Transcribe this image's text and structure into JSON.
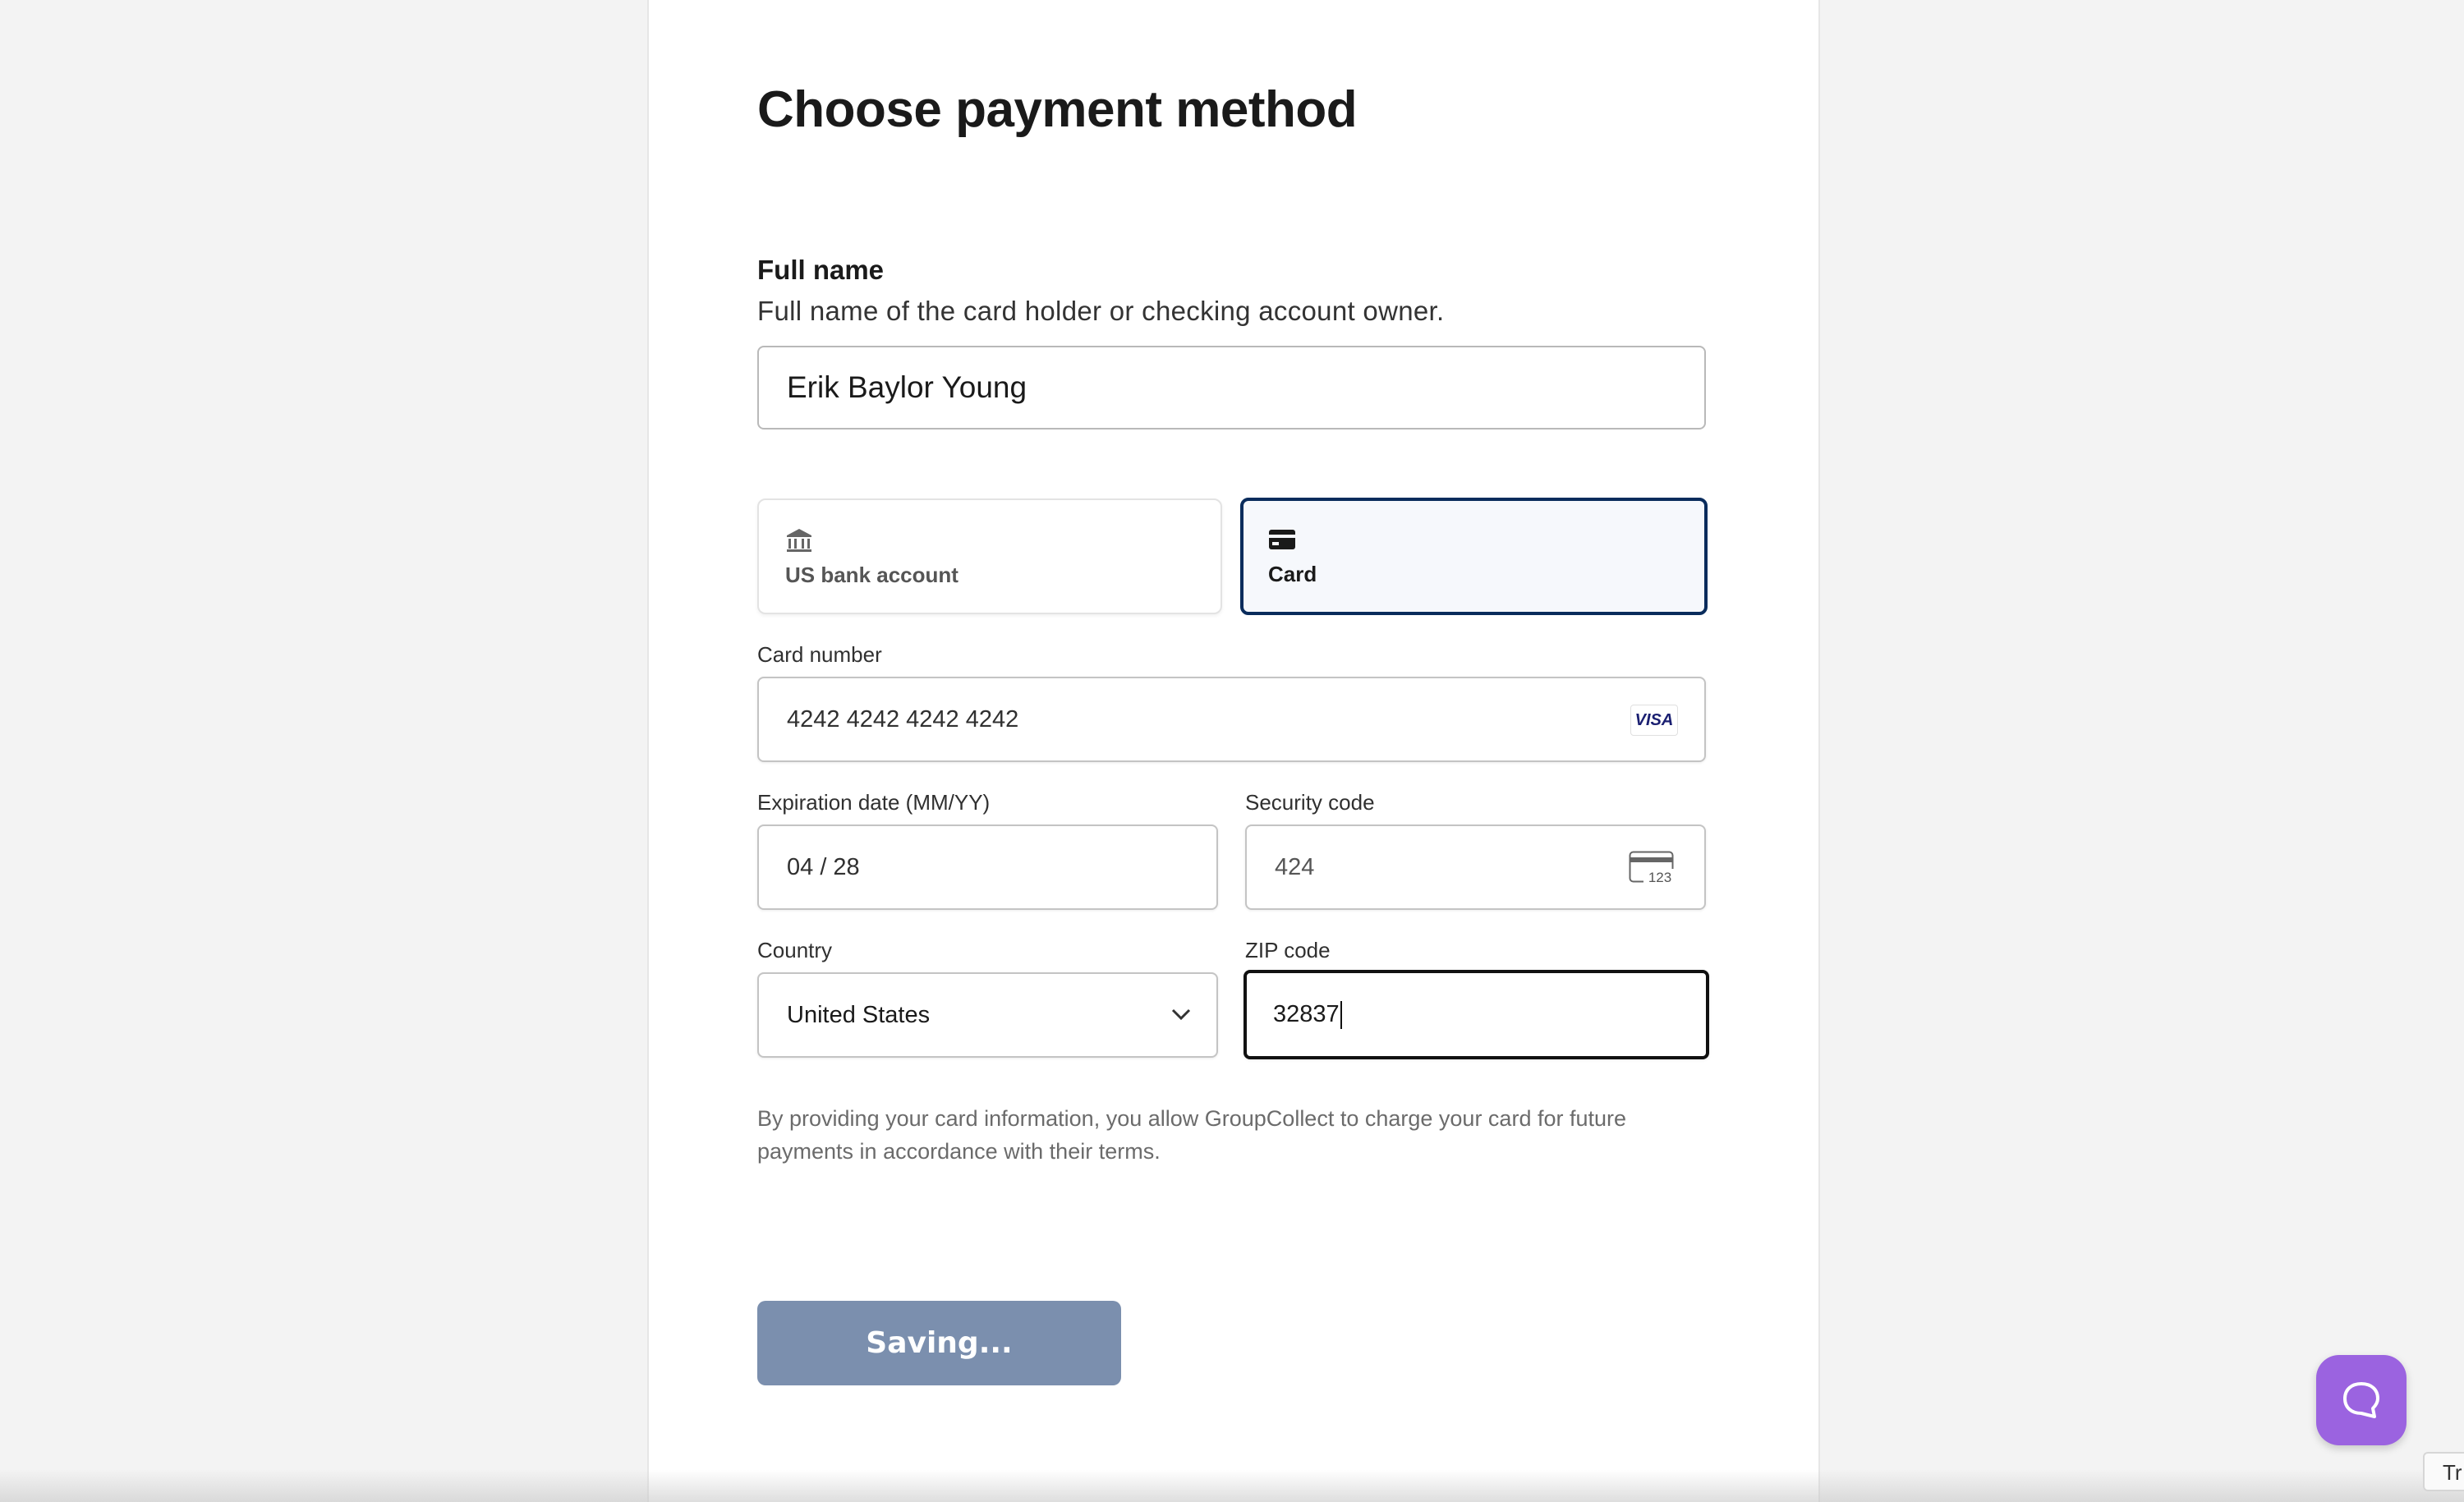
{
  "header": {
    "title": "Choose payment method"
  },
  "full_name": {
    "label": "Full name",
    "help": "Full name of the card holder or checking account owner.",
    "value": "Erik Baylor Young"
  },
  "payment_tabs": {
    "bank": {
      "label": "US bank account",
      "icon": "bank-icon"
    },
    "card": {
      "label": "Card",
      "icon": "credit-card-icon",
      "selected": true
    }
  },
  "card_form": {
    "card_number": {
      "label": "Card number",
      "value": "4242 4242 4242 4242",
      "brand": "VISA"
    },
    "expiry": {
      "label": "Expiration date (MM/YY)",
      "value": "04 / 28"
    },
    "security_code": {
      "label": "Security code",
      "value": "424",
      "icon_text": "123"
    },
    "country": {
      "label": "Country",
      "value": "United States"
    },
    "zip": {
      "label": "ZIP code",
      "value": "32837"
    }
  },
  "notice": "By providing your card information, you allow GroupCollect to charge your card for future payments in accordance with their terms.",
  "save_button": {
    "label": "Saving..."
  },
  "corner_tab": {
    "label": "Tr"
  },
  "colors": {
    "accent": "#0a2c5c",
    "button_disabled": "#7b8fae",
    "help_fab": "#9b63e0"
  }
}
